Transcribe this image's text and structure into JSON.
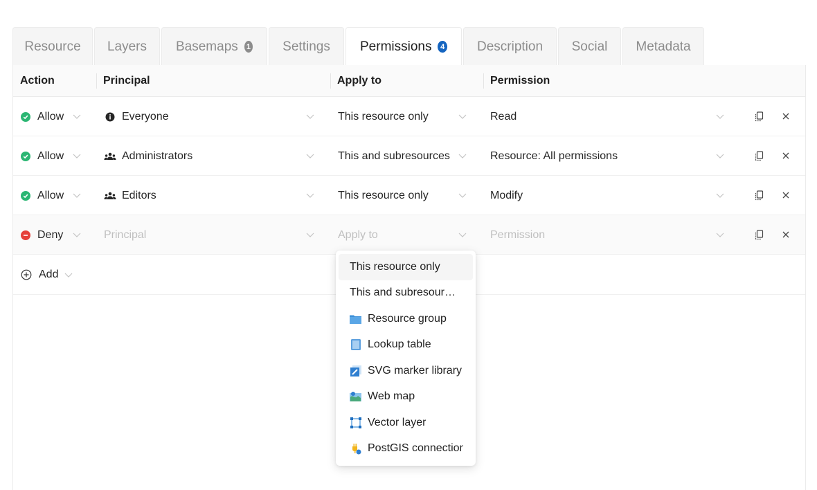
{
  "tabs": [
    {
      "label": "Resource",
      "badge": null,
      "active": false
    },
    {
      "label": "Layers",
      "badge": null,
      "active": false
    },
    {
      "label": "Basemaps",
      "badge": "1",
      "active": false
    },
    {
      "label": "Settings",
      "badge": null,
      "active": false
    },
    {
      "label": "Permissions",
      "badge": "4",
      "active": true
    },
    {
      "label": "Description",
      "badge": null,
      "active": false
    },
    {
      "label": "Social",
      "badge": null,
      "active": false
    },
    {
      "label": "Metadata",
      "badge": null,
      "active": false
    }
  ],
  "table": {
    "columns": [
      "Action",
      "Principal",
      "Apply to",
      "Permission"
    ],
    "rows": [
      {
        "action": "Allow",
        "action_type": "allow",
        "principal": "Everyone",
        "principal_icon": "info-icon",
        "apply_to": "This resource only",
        "permission": "Read"
      },
      {
        "action": "Allow",
        "action_type": "allow",
        "principal": "Administrators",
        "principal_icon": "group-icon",
        "apply_to": "This and subresources",
        "permission": "Resource: All permissions"
      },
      {
        "action": "Allow",
        "action_type": "allow",
        "principal": "Editors",
        "principal_icon": "group-icon",
        "apply_to": "This resource only",
        "permission": "Modify"
      }
    ],
    "new_row": {
      "action": "Deny",
      "action_type": "deny",
      "principal_placeholder": "Principal",
      "apply_to_placeholder": "Apply to",
      "permission_placeholder": "Permission"
    },
    "add_label": "Add"
  },
  "dropdown": {
    "options": [
      {
        "label": "This resource only",
        "icon": null,
        "hover": true
      },
      {
        "label": "This and subresources",
        "icon": null,
        "hover": false
      },
      {
        "label": "Resource group",
        "icon": "folder-icon",
        "hover": false
      },
      {
        "label": "Lookup table",
        "icon": "lookup-table-icon",
        "hover": false
      },
      {
        "label": "SVG marker library",
        "icon": "svg-marker-library-icon",
        "hover": false
      },
      {
        "label": "Web map",
        "icon": "web-map-icon",
        "hover": false
      },
      {
        "label": "Vector layer",
        "icon": "vector-layer-icon",
        "hover": false
      },
      {
        "label": "PostGIS connection",
        "icon": "postgis-connection-icon",
        "hover": false
      }
    ]
  },
  "colors": {
    "allow": "#2bb673",
    "deny": "#e5403a",
    "active_badge": "#1565c0",
    "inactive_badge": "#8c8c8c"
  }
}
